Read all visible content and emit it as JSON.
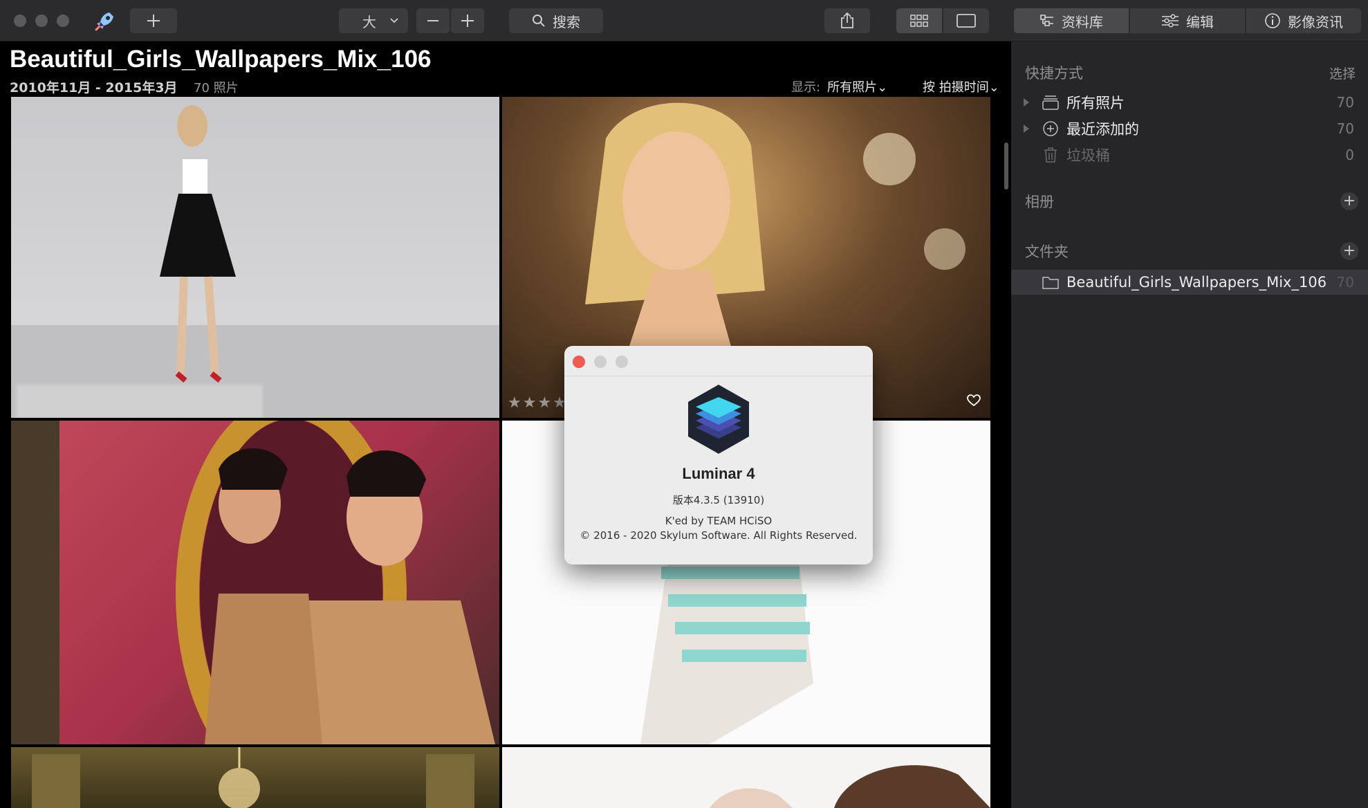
{
  "toolbar": {
    "size_label": "大",
    "zoom_out": "—",
    "zoom_in": "+",
    "search_label": "搜索",
    "tabs": [
      {
        "label": "资料库"
      },
      {
        "label": "编辑"
      },
      {
        "label": "影像资讯"
      }
    ]
  },
  "header": {
    "title": "Beautiful_Girls_Wallpapers_Mix_106",
    "date_range": "2010年11月 - 2015年3月",
    "photo_count": "70 照片",
    "display_label": "显示:",
    "display_value": "所有照片⌄",
    "sort_label": "按 拍摄时间⌄"
  },
  "sidebar": {
    "shortcuts_heading": "快捷方式",
    "select_action": "选择",
    "shortcuts": [
      {
        "label": "所有照片",
        "count": "70"
      },
      {
        "label": "最近添加的",
        "count": "70"
      },
      {
        "label": "垃圾桶",
        "count": "0"
      }
    ],
    "albums_heading": "相册",
    "folders_heading": "文件夹",
    "folders": [
      {
        "label": "Beautiful_Girls_Wallpapers_Mix_106",
        "count": "70"
      }
    ]
  },
  "about_dialog": {
    "app_name": "Luminar 4",
    "version": "版本4.3.5 (13910)",
    "credit": "K'ed by TEAM HCiSO",
    "copyright": "© 2016 - 2020 Skylum Software. All Rights Reserved."
  },
  "photo": {
    "stars": "★★★★"
  }
}
